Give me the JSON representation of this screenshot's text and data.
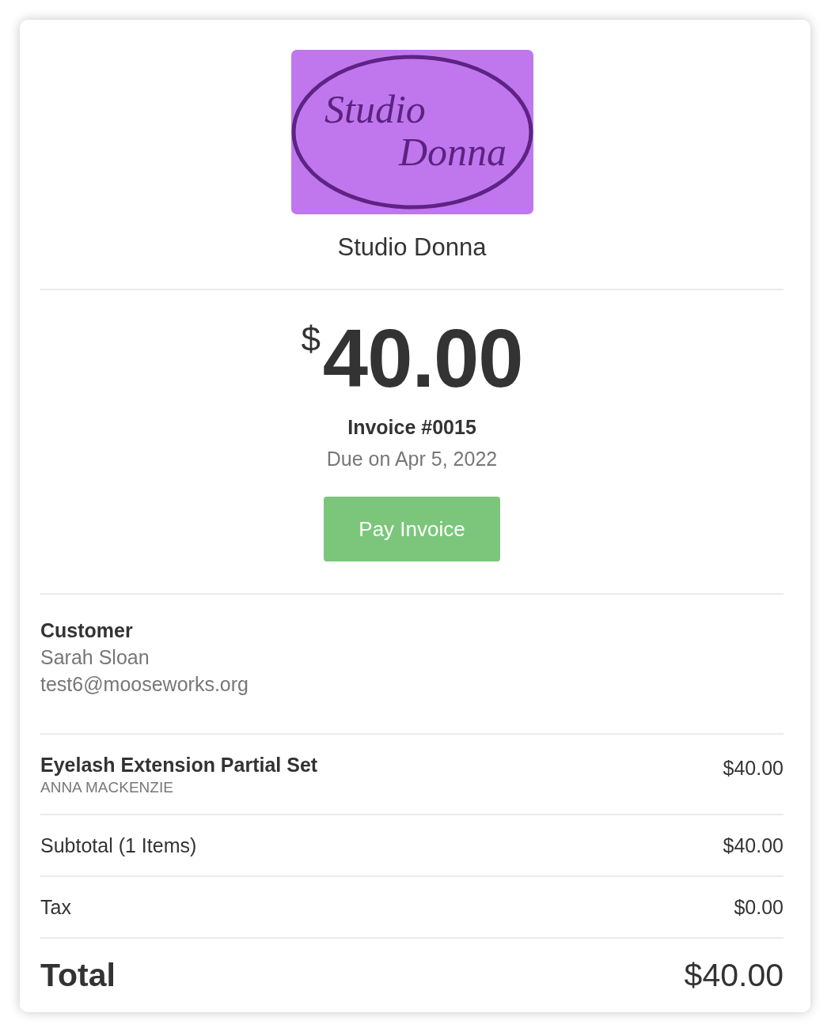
{
  "logo": {
    "line_1": "Studio",
    "line_2": "Donna"
  },
  "business_name": "Studio Donna",
  "amount": {
    "currency": "$",
    "value": "40.00"
  },
  "invoice_number": "Invoice #0015",
  "due_date": "Due on Apr 5, 2022",
  "pay_button": "Pay Invoice",
  "customer": {
    "heading": "Customer",
    "name": "Sarah Sloan",
    "email": "test6@mooseworks.org"
  },
  "line_items": [
    {
      "name": "Eyelash Extension Partial Set",
      "staff": "ANNA MACKENZIE",
      "price": "$40.00"
    }
  ],
  "summary": [
    {
      "kind": "subtotal",
      "label": "Subtotal (1 Items)",
      "amount": "$40.00"
    },
    {
      "kind": "tax",
      "label": "Tax",
      "amount": "$0.00"
    },
    {
      "kind": "total",
      "label": "Total",
      "amount": "$40.00"
    }
  ]
}
